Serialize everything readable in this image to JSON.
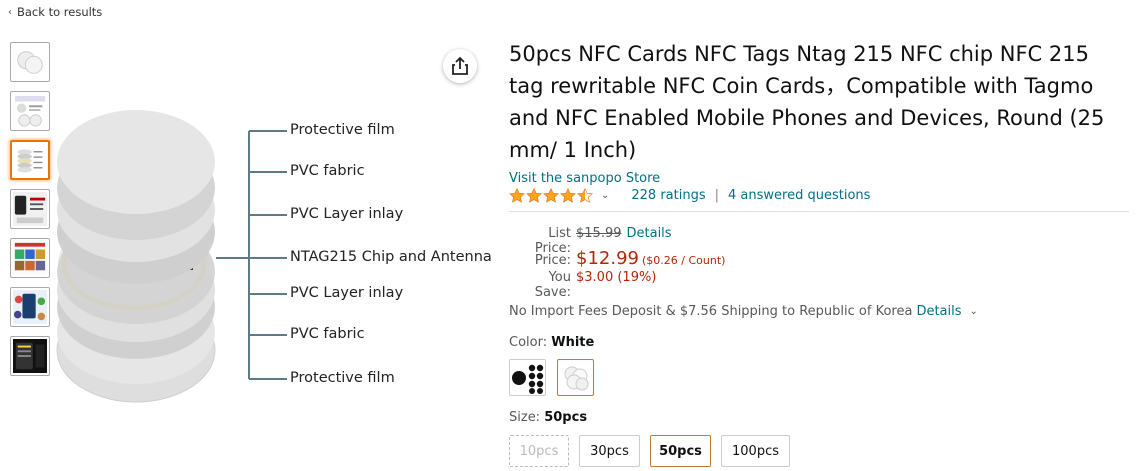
{
  "nav": {
    "back_label": "Back to results"
  },
  "diagram": {
    "layers": [
      "Protective film",
      "PVC fabric",
      "PVC Layer inlay",
      "NTAG215 Chip and Antenna",
      "PVC Layer inlay",
      "PVC fabric",
      "Protective film"
    ]
  },
  "product": {
    "title": "50pcs NFC Cards NFC Tags Ntag 215 NFC chip NFC 215 tag rewritable NFC Coin Cards，Compatible with Tagmo and NFC Enabled Mobile Phones and Devices, Round (25 mm/ 1 Inch)",
    "store_link": "Visit the sanpopo Store",
    "rating": 4.5,
    "ratings_count": "228 ratings",
    "answered": "4 answered questions"
  },
  "pricing": {
    "list_label": "List Price:",
    "list_price": "$15.99",
    "details_link": "Details",
    "price_label": "Price:",
    "price": "$12.99",
    "unit_price": "($0.26 / Count)",
    "save_label": "You Save:",
    "save_value": "$3.00 (19%)"
  },
  "shipping": {
    "text": "No Import Fees Deposit & $7.56 Shipping to Republic of Korea",
    "details_link": "Details"
  },
  "color": {
    "label": "Color:",
    "selected": "White",
    "options": [
      "Black",
      "White"
    ]
  },
  "size": {
    "label": "Size:",
    "selected": "50pcs",
    "options": [
      "10pcs",
      "30pcs",
      "50pcs",
      "100pcs"
    ]
  },
  "colors": {
    "link": "#007185",
    "price": "#B12704",
    "star": "#FFA41C",
    "selected_border": "#c47a2c"
  }
}
